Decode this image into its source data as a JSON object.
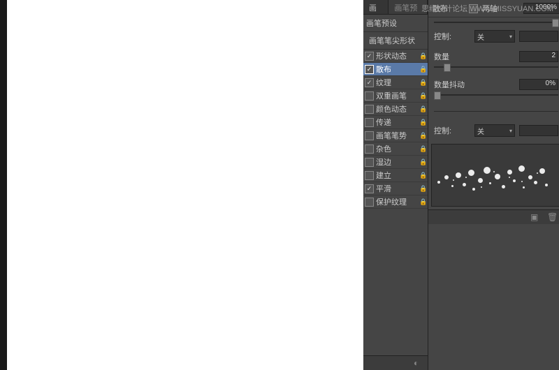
{
  "watermark": "思缘设计论坛  WWW.MISSYUAN.COM",
  "leftPanel": {
    "tabs": [
      "画笔",
      "画笔预设"
    ],
    "presetLabel": "画笔预设",
    "tipLabel": "画笔笔尖形状",
    "options": [
      {
        "label": "形状动态",
        "checked": true,
        "locked": true
      },
      {
        "label": "散布",
        "checked": true,
        "locked": true,
        "selected": true
      },
      {
        "label": "纹理",
        "checked": true,
        "locked": true
      },
      {
        "label": "双重画笔",
        "checked": false,
        "locked": true
      },
      {
        "label": "颜色动态",
        "checked": false,
        "locked": true
      },
      {
        "label": "传递",
        "checked": false,
        "locked": true
      },
      {
        "label": "画笔笔势",
        "checked": false,
        "locked": true
      },
      {
        "label": "杂色",
        "checked": false,
        "locked": true
      },
      {
        "label": "湿边",
        "checked": false,
        "locked": true
      },
      {
        "label": "建立",
        "checked": false,
        "locked": true
      },
      {
        "label": "平滑",
        "checked": true,
        "locked": true
      },
      {
        "label": "保护纹理",
        "checked": false,
        "locked": true
      }
    ]
  },
  "rightPanel": {
    "top": {
      "scatterLabel": "散布",
      "bothAxesLabel": "两轴",
      "bothAxesChecked": false,
      "value": "1000%"
    },
    "control1Label": "控制:",
    "control1Value": "关",
    "countLabel": "数量",
    "countValue": "2",
    "jitterLabel": "数量抖动",
    "jitterValue": "0%",
    "control2Label": "控制:",
    "control2Value": "关"
  }
}
